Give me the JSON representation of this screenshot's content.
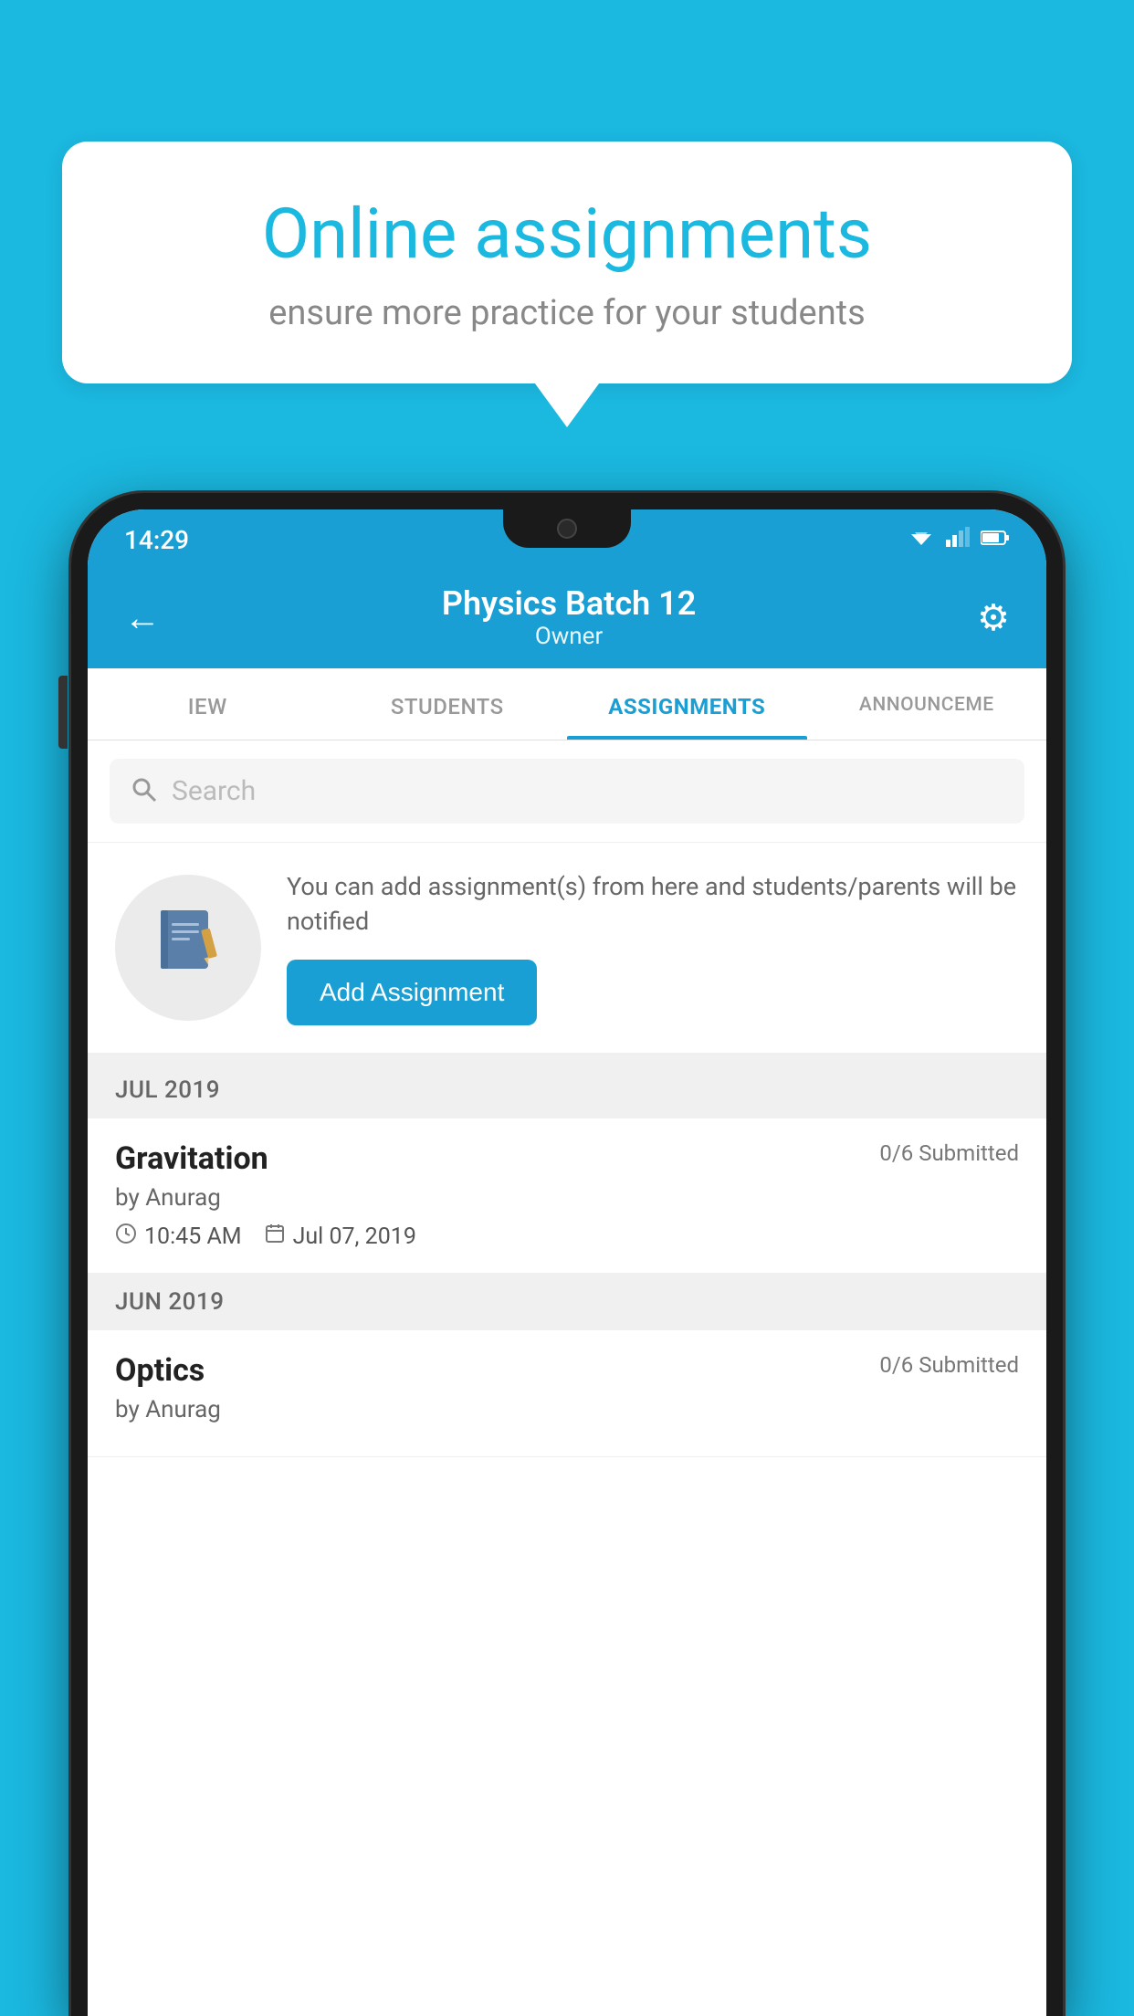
{
  "background_color": "#1bb8e0",
  "bubble": {
    "title": "Online assignments",
    "subtitle": "ensure more practice for your students"
  },
  "status_bar": {
    "time": "14:29",
    "wifi": "▼",
    "signal": "◀",
    "battery": "▮"
  },
  "header": {
    "title": "Physics Batch 12",
    "subtitle": "Owner",
    "back_label": "←",
    "gear_label": "⚙"
  },
  "tabs": [
    {
      "label": "IEW",
      "active": false
    },
    {
      "label": "STUDENTS",
      "active": false
    },
    {
      "label": "ASSIGNMENTS",
      "active": true
    },
    {
      "label": "ANNOUNCEME",
      "active": false
    }
  ],
  "search": {
    "placeholder": "Search"
  },
  "promo": {
    "text": "You can add assignment(s) from here and students/parents will be notified",
    "button_label": "Add Assignment"
  },
  "assignment_groups": [
    {
      "month_label": "JUL 2019",
      "assignments": [
        {
          "title": "Gravitation",
          "submitted": "0/6 Submitted",
          "author": "by Anurag",
          "time": "10:45 AM",
          "date": "Jul 07, 2019"
        }
      ]
    },
    {
      "month_label": "JUN 2019",
      "assignments": [
        {
          "title": "Optics",
          "submitted": "0/6 Submitted",
          "author": "by Anurag",
          "time": "",
          "date": ""
        }
      ]
    }
  ]
}
